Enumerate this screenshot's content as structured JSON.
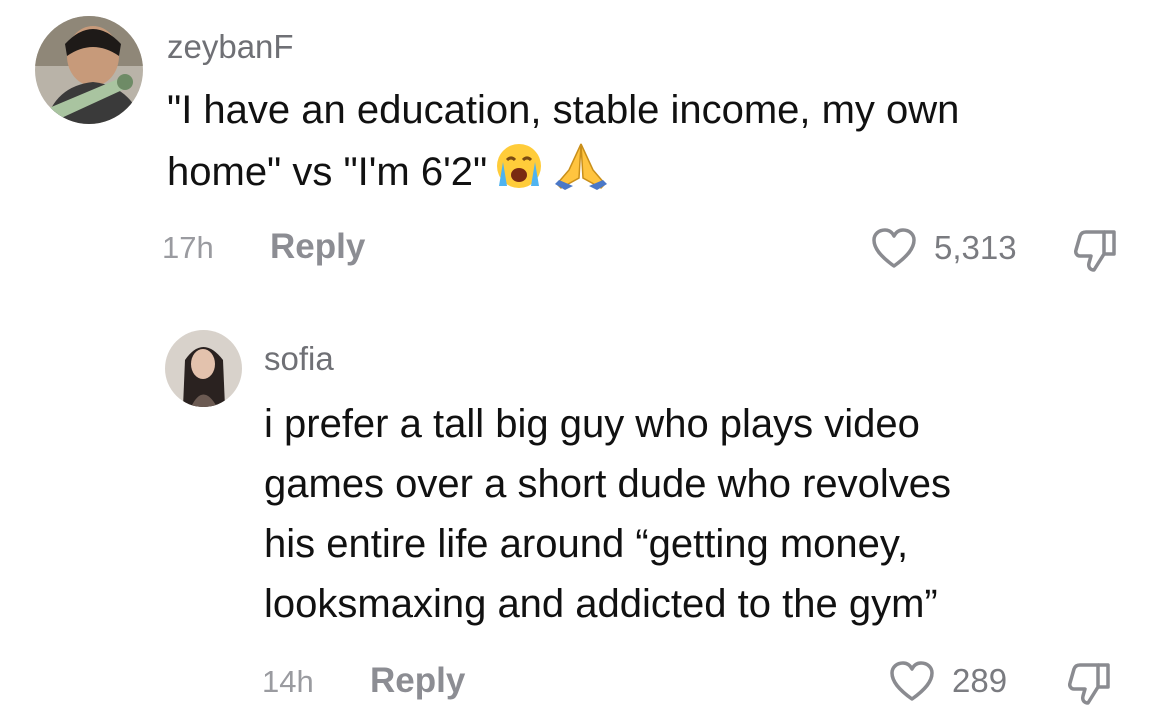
{
  "comments": [
    {
      "username": "zeybanF",
      "text_lines": [
        "\"I have an education, stable income, my own",
        "home\" vs \"I'm 6'2\""
      ],
      "emojis": [
        "crying-face-emoji",
        "folded-hands-emoji"
      ],
      "time": "17h",
      "reply_label": "Reply",
      "likes": "5,313"
    },
    {
      "username": "sofia",
      "text_lines": [
        "i prefer a tall big guy who plays video",
        "games over a short dude who revolves",
        "his entire life around “getting money,",
        "looksmaxing and addicted to the gym”"
      ],
      "time": "14h",
      "reply_label": "Reply",
      "likes": "289"
    }
  ],
  "icons": {
    "like": "heart-outline-icon",
    "dislike": "thumbs-down-outline-icon"
  },
  "colors": {
    "username": "#6f7075",
    "body": "#111111",
    "meta": "#9a9ba0",
    "reply": "#8c8d93"
  }
}
